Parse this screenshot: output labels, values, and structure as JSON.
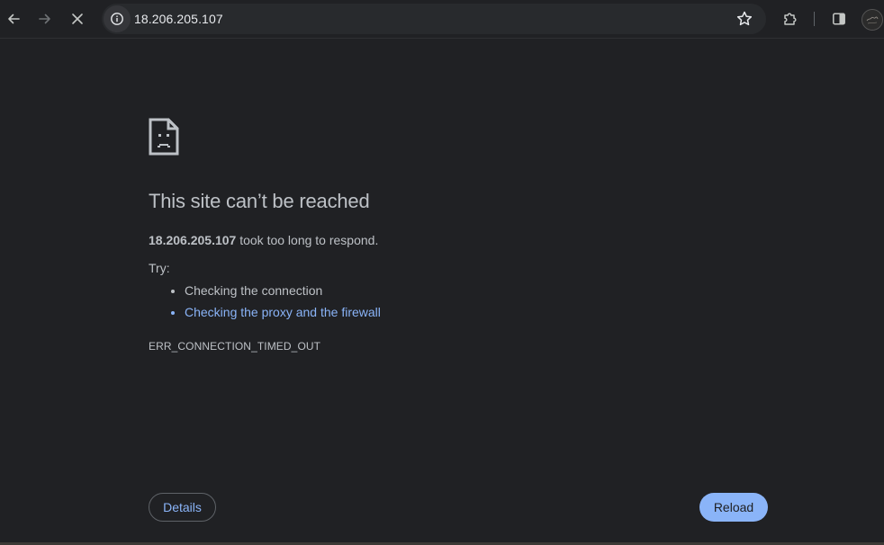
{
  "browser": {
    "url": "18.206.205.107",
    "icons": {
      "back": "arrow-left-icon",
      "forward": "arrow-right-icon",
      "stop": "close-icon",
      "site_info": "info-icon",
      "bookmark": "star-icon",
      "extensions": "puzzle-icon",
      "side_panel": "side-panel-icon",
      "profile": "avatar"
    }
  },
  "error_page": {
    "title": "This site can’t be reached",
    "host": "18.206.205.107",
    "description_suffix": " took too long to respond.",
    "try_label": "Try:",
    "suggestions": [
      {
        "label": "Checking the connection",
        "is_link": false
      },
      {
        "label": "Checking the proxy and the firewall",
        "is_link": true
      }
    ],
    "error_code": "ERR_CONNECTION_TIMED_OUT",
    "details_label": "Details",
    "reload_label": "Reload"
  },
  "colors": {
    "background": "#202124",
    "text": "#bdc1c6",
    "link": "#8ab4f8",
    "button_primary": "#8ab4f8"
  }
}
